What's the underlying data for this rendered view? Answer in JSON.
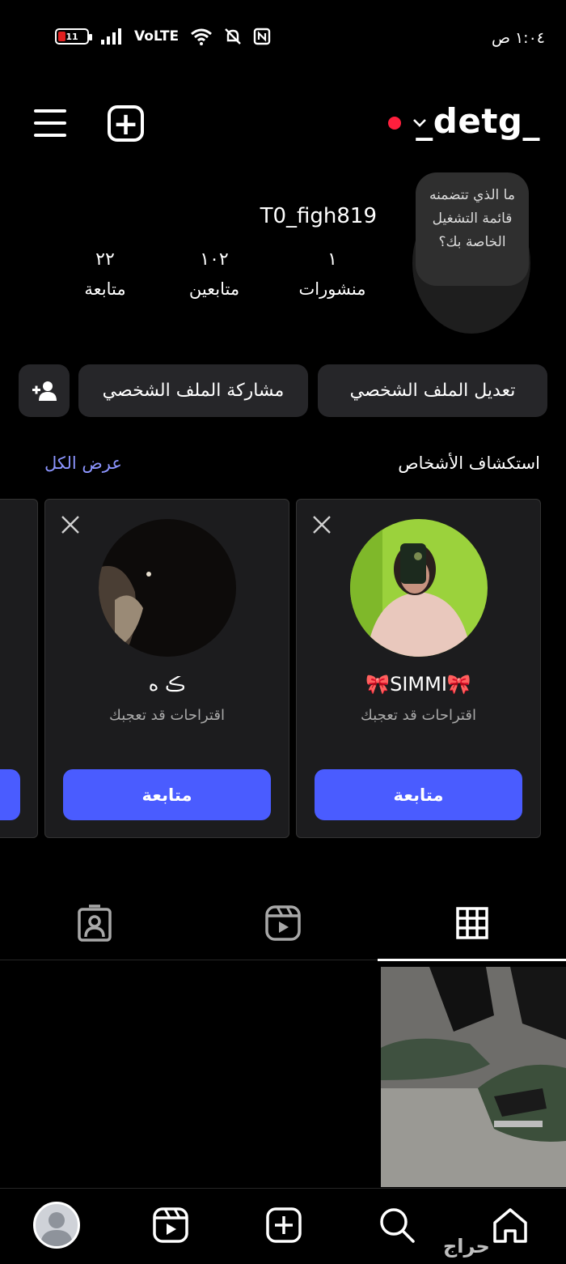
{
  "status_bar": {
    "time": "١:٠٤ ص",
    "battery_level": "11",
    "network": "VoLTE"
  },
  "header": {
    "username": "_detg_",
    "menu_icon": "hamburger-icon",
    "add_icon": "plus-square-icon"
  },
  "profile": {
    "display_name": "T0_figh819",
    "tooltip": "ما الذي تتضمنه قائمة التشغيل الخاصة بك؟",
    "stats": {
      "posts_value": "١",
      "posts_label": "منشورات",
      "followers_value": "١٠٢",
      "followers_label": "متابعين",
      "following_value": "٢٢",
      "following_label": "متابعة"
    }
  },
  "actions": {
    "edit_profile": "تعديل الملف الشخصي",
    "share_profile": "مشاركة الملف الشخصي"
  },
  "discover": {
    "title": "استكشاف الأشخاص",
    "see_all": "عرض الكل",
    "cards": [
      {
        "name": "🎀SIMMI🎀",
        "subtitle": "اقتراحات قد تعجبك",
        "button": "متابعة"
      },
      {
        "name": "ڪ ه",
        "subtitle": "اقتراحات قد تعجبك",
        "button": "متابعة"
      }
    ]
  },
  "tabs": [
    "grid-icon",
    "reels-icon",
    "tagged-icon"
  ],
  "bottom_nav": [
    "home-icon",
    "search-icon",
    "add-icon",
    "reels-icon",
    "profile-avatar"
  ],
  "watermark": "حراج",
  "colors": {
    "accent": "#4a5cff",
    "link": "#8c95ff",
    "button_bg": "#262629",
    "card_bg": "#1c1c1e",
    "notification_dot": "#ff1f3d"
  }
}
